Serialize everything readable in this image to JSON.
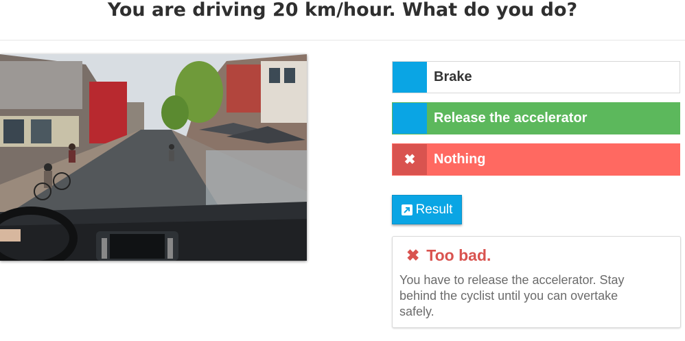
{
  "question": {
    "title": "You are driving 20 km/hour. What do you do?"
  },
  "options": [
    {
      "label": "Brake",
      "state": "neutral",
      "marker_icon": ""
    },
    {
      "label": "Release the accelerator",
      "state": "correct",
      "marker_icon": ""
    },
    {
      "label": "Nothing",
      "state": "selected-wrong",
      "marker_icon": "✖"
    }
  ],
  "result_button": {
    "label": "Result",
    "icon": "external-link-icon"
  },
  "feedback": {
    "icon": "✖",
    "heading": "Too bad.",
    "text": "You have to release the accelerator. Stay behind the cyclist until you can overtake safely."
  },
  "colors": {
    "accent_blue": "#0aa5e4",
    "correct_green": "#5cb85c",
    "wrong_red": "#ff6961",
    "wrong_dark_red": "#d9534f"
  }
}
